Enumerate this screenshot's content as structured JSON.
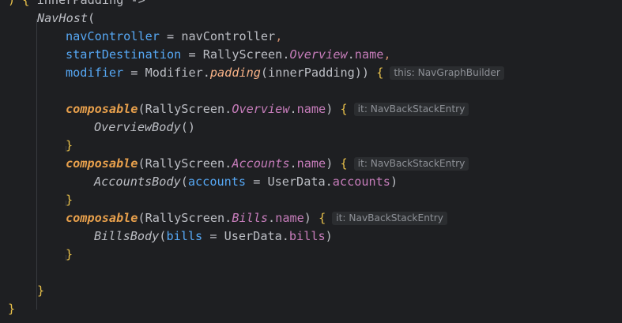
{
  "editor": {
    "lines": {
      "l0": {
        "open": ") { ",
        "name": "innerPadding",
        "arrow": " ->"
      },
      "l1": {
        "call": "NavHost",
        "paren": "("
      },
      "l2": {
        "param": "navController",
        "eq": " = ",
        "value": "navController",
        "comma": ","
      },
      "l3": {
        "param": "startDestination",
        "eq": " = ",
        "cls": "RallyScreen.",
        "enum": "Overview",
        "dot": ".",
        "prop": "name",
        "comma": ","
      },
      "l4": {
        "param": "modifier",
        "eq": " = ",
        "cls": "Modifier.",
        "fn": "padding",
        "args": "(innerPadding)) ",
        "brace": "{",
        "hint": "this: NavGraphBuilder"
      },
      "l6": {
        "fn": "composable",
        "cls": "(RallyScreen.",
        "enum": "Overview",
        "dot": ".",
        "prop": "name",
        "close": ") ",
        "brace": "{",
        "hint": "it: NavBackStackEntry"
      },
      "l7": {
        "call": "OverviewBody",
        "paren": "()"
      },
      "l8": {
        "brace": "}"
      },
      "l9": {
        "fn": "composable",
        "cls": "(RallyScreen.",
        "enum": "Accounts",
        "dot": ".",
        "prop": "name",
        "close": ") ",
        "brace": "{",
        "hint": "it: NavBackStackEntry"
      },
      "l10": {
        "call": "AccountsBody",
        "open": "(",
        "param": "accounts",
        "eq": " = ",
        "cls": "UserData.",
        "prop": "accounts",
        "close": ")"
      },
      "l11": {
        "brace": "}"
      },
      "l12": {
        "fn": "composable",
        "cls": "(RallyScreen.",
        "enum": "Bills",
        "dot": ".",
        "prop": "name",
        "close": ") ",
        "brace": "{",
        "hint": "it: NavBackStackEntry"
      },
      "l13": {
        "call": "BillsBody",
        "open": "(",
        "param": "bills",
        "eq": " = ",
        "cls": "UserData.",
        "prop": "bills",
        "close": ")"
      },
      "l14": {
        "brace": "}"
      },
      "l16": {
        "brace": "}"
      },
      "l17": {
        "brace": "}"
      }
    }
  }
}
